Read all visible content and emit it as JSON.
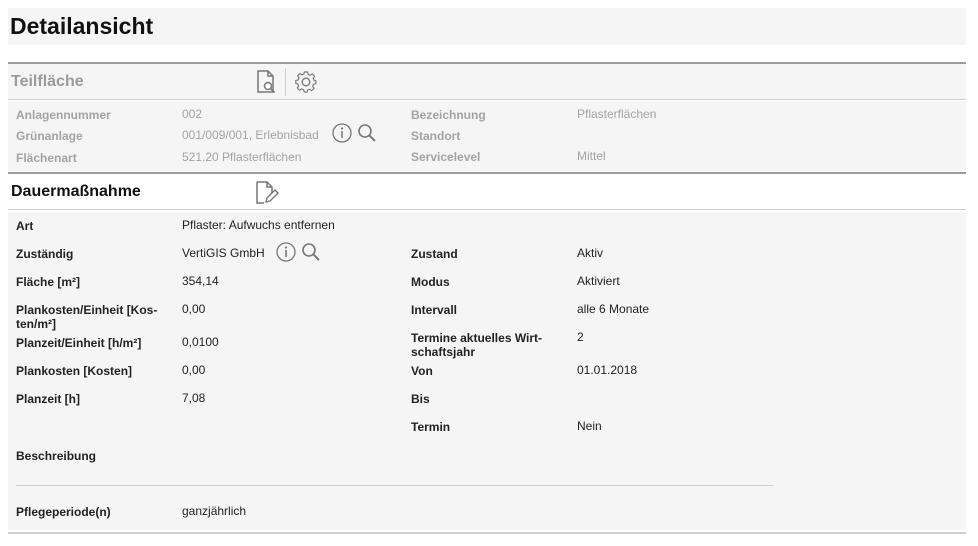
{
  "page": {
    "title": "Detailansicht"
  },
  "teilflaeche": {
    "title": "Teilfläche",
    "icons": [
      "document-search-icon",
      "gear-icon"
    ],
    "fields": {
      "anlagennummer": {
        "label": "Anlagennummer",
        "value": "002"
      },
      "gruenanlage": {
        "label": "Grünanlage",
        "value": "001/009/001, Erlebnisbad"
      },
      "flaechenart": {
        "label": "Flächenart",
        "value": "521.20 Pflasterflächen"
      },
      "bezeichnung": {
        "label": "Bezeichnung",
        "value": "Pflasterflächen"
      },
      "standort": {
        "label": "Standort",
        "value": ""
      },
      "servicelevel": {
        "label": "Servicelevel",
        "value": "Mittel"
      }
    }
  },
  "dauermassnahme": {
    "title": "Dauermaßnahme",
    "icons": [
      "document-edit-icon"
    ],
    "fields": {
      "art": {
        "label": "Art",
        "value": "Pflaster: Aufwuchs entfernen"
      },
      "zustaendig": {
        "label": "Zuständig",
        "value": "VertiGIS GmbH"
      },
      "flaeche": {
        "label": "Fläche [m²]",
        "value": "354,14"
      },
      "plankosten_einheit": {
        "label": "Plankosten/Einheit [Kos-ten/m²]",
        "value": "0,00"
      },
      "planzeit_einheit": {
        "label": "Planzeit/Einheit [h/m²]",
        "value": "0,0100"
      },
      "plankosten": {
        "label": "Plankosten [Kosten]",
        "value": "0,00"
      },
      "planzeit": {
        "label": "Planzeit [h]",
        "value": "7,08"
      },
      "beschreibung": {
        "label": "Beschreibung",
        "value": ""
      },
      "pflegeperiode": {
        "label": "Pflegeperiode(n)",
        "value": "ganzjährlich"
      },
      "zustand": {
        "label": "Zustand",
        "value": "Aktiv"
      },
      "modus": {
        "label": "Modus",
        "value": "Aktiviert"
      },
      "intervall": {
        "label": "Intervall",
        "value": "alle 6 Monate"
      },
      "termine": {
        "label": "Termine aktuelles Wirt-schaftsjahr",
        "value": "2"
      },
      "von": {
        "label": "Von",
        "value": "01.01.2018"
      },
      "bis": {
        "label": "Bis",
        "value": ""
      },
      "termin": {
        "label": "Termin",
        "value": "Nein"
      }
    }
  },
  "colors": {
    "panel_bg": "#f5f5f5",
    "muted_text": "#a3a3a3",
    "border": "#9c9c9c"
  }
}
